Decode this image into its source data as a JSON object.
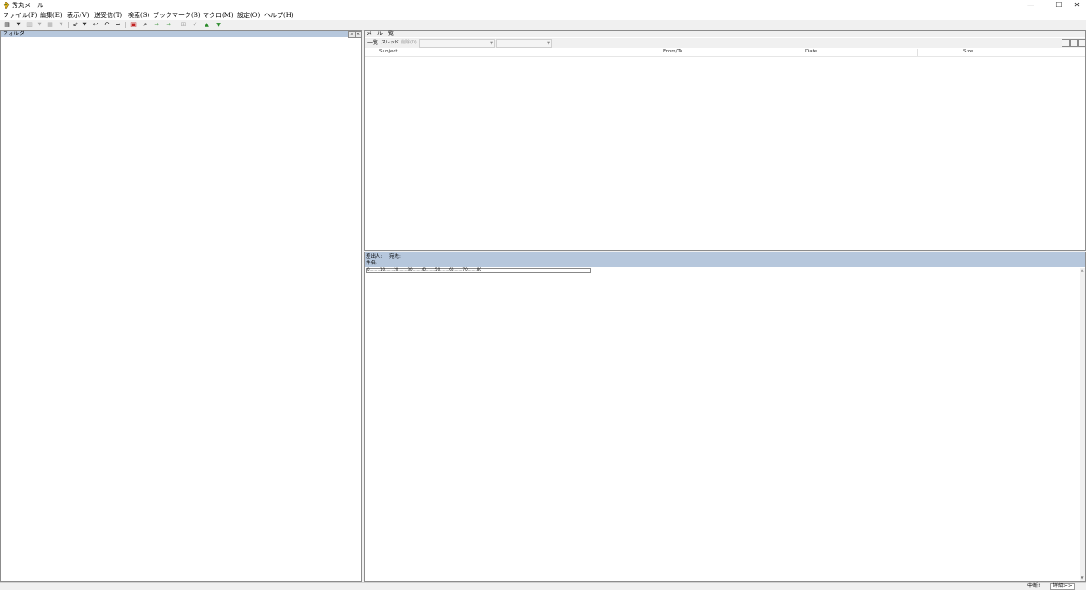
{
  "window": {
    "title": "秀丸メール",
    "minimize": "—",
    "maximize": "☐",
    "close": "✕"
  },
  "menu": [
    "ファイル(F)",
    "編集(E)",
    "表示(V)",
    "送受信(T)",
    "検索(S)",
    "ブックマーク(B)",
    "マクロ(M)",
    "設定(O)",
    "ヘルプ(H)"
  ],
  "toolbar": [
    {
      "name": "save-icon",
      "glyph": "▤",
      "enabled": true
    },
    {
      "name": "print-icon",
      "glyph": "▥",
      "enabled": false
    },
    {
      "name": "address-book-icon",
      "glyph": "▦",
      "enabled": false
    },
    {
      "name": "receive-icon",
      "glyph": "⇙",
      "enabled": true
    },
    {
      "name": "reply-icon",
      "glyph": "↩",
      "enabled": true
    },
    {
      "name": "reply-all-icon",
      "glyph": "↶",
      "enabled": true
    },
    {
      "name": "forward-icon",
      "glyph": "➡",
      "enabled": true
    },
    {
      "name": "delete-icon",
      "glyph": "▣",
      "enabled": true
    },
    {
      "name": "search-icon",
      "glyph": "⌕",
      "enabled": true
    },
    {
      "name": "next-unread-icon",
      "glyph": "⇨",
      "enabled": true
    },
    {
      "name": "next-mail-icon",
      "glyph": "⇨",
      "enabled": true
    },
    {
      "name": "filter-icon",
      "glyph": "⊞",
      "enabled": false
    },
    {
      "name": "check-icon",
      "glyph": "✓",
      "enabled": false
    },
    {
      "name": "up-icon",
      "glyph": "▲",
      "enabled": true
    },
    {
      "name": "down-icon",
      "glyph": "▼",
      "enabled": true
    }
  ],
  "folder_pane": {
    "title": "フォルダ"
  },
  "mail_pane": {
    "title": "メール一覧",
    "tabs": [
      {
        "label": "一覧",
        "enabled": true
      },
      {
        "label": "スレッド",
        "enabled": true
      },
      {
        "label": "削除(D)",
        "enabled": false
      }
    ],
    "columns": [
      "Subject",
      "From/To",
      "Date",
      "Size"
    ]
  },
  "preview_pane": {
    "from_label": "差出人:",
    "to_label": "宛先:",
    "subject_label": "件名:",
    "ruler": "0.........10........20........30........40........50........60........70........80"
  },
  "status_bar": {
    "state": "中断!",
    "detail": "詳細>>"
  },
  "colors": {
    "pane_header": "#b6c7dc",
    "background": "#f0f0f0"
  }
}
